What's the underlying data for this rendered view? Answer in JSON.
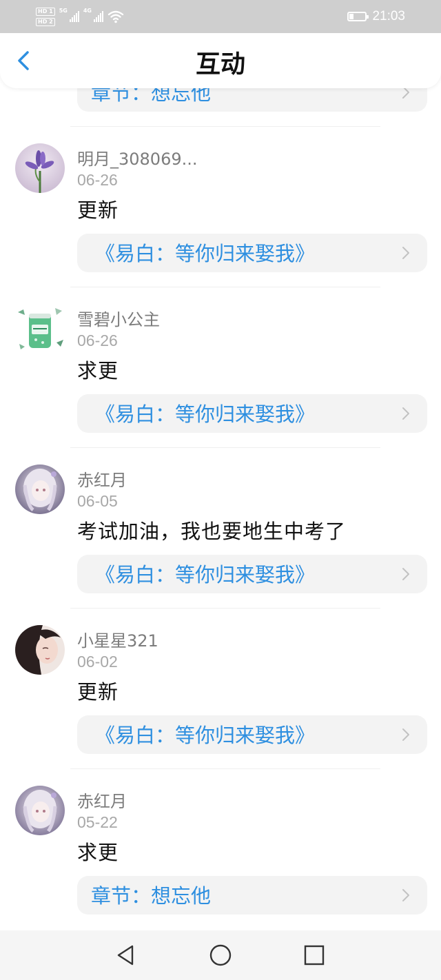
{
  "status_bar": {
    "hd1": "HD 1",
    "hd2": "HD 2",
    "net1": "5G",
    "net2": "4G",
    "time": "21:03"
  },
  "header": {
    "title": "互动",
    "back_icon": "chevron-left-icon"
  },
  "top_partial": {
    "link_text": "章节：想忘他"
  },
  "comments": [
    {
      "username": "明月_308069...",
      "date": "06-26",
      "text": "更新",
      "link": "《易白：等你归来娶我》",
      "avatar_icon": "iris-flower-avatar"
    },
    {
      "username": "雪碧小公主",
      "date": "06-26",
      "text": "求更",
      "link": "《易白：等你归来娶我》",
      "avatar_icon": "soda-can-avatar"
    },
    {
      "username": "赤红月",
      "date": "06-05",
      "text": "考试加油，我也要地生中考了",
      "link": "《易白：等你归来娶我》",
      "avatar_icon": "anime-girl-avatar"
    },
    {
      "username": "小星星321",
      "date": "06-02",
      "text": "更新",
      "link": "《易白：等你归来娶我》",
      "avatar_icon": "dark-hair-girl-avatar"
    },
    {
      "username": "赤红月",
      "date": "05-22",
      "text": "求更",
      "link": "章节：想忘他",
      "avatar_icon": "anime-girl-avatar"
    }
  ],
  "colors": {
    "link": "#2e8fe0",
    "link_bg": "#f3f3f3",
    "username": "#7c7c7c",
    "date": "#a8a8a8",
    "status_bar": "#cfcfcf"
  },
  "nav": {
    "back": "triangle-back-icon",
    "home": "circle-home-icon",
    "recent": "square-recent-icon"
  }
}
